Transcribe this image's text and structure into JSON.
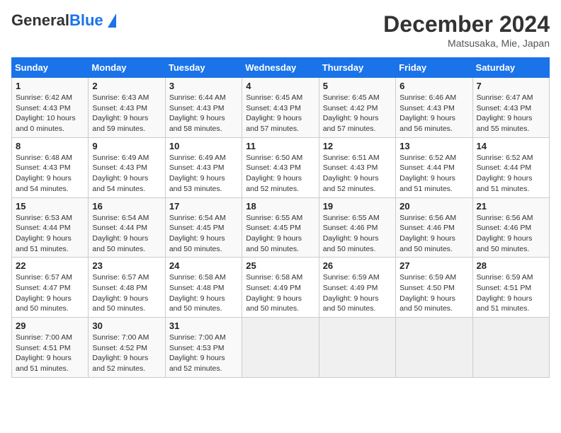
{
  "header": {
    "logo_general": "General",
    "logo_blue": "Blue",
    "title": "December 2024",
    "subtitle": "Matsusaka, Mie, Japan"
  },
  "calendar": {
    "days_of_week": [
      "Sunday",
      "Monday",
      "Tuesday",
      "Wednesday",
      "Thursday",
      "Friday",
      "Saturday"
    ],
    "weeks": [
      [
        {
          "day": "1",
          "sunrise": "Sunrise: 6:42 AM",
          "sunset": "Sunset: 4:43 PM",
          "daylight": "Daylight: 10 hours and 0 minutes."
        },
        {
          "day": "2",
          "sunrise": "Sunrise: 6:43 AM",
          "sunset": "Sunset: 4:43 PM",
          "daylight": "Daylight: 9 hours and 59 minutes."
        },
        {
          "day": "3",
          "sunrise": "Sunrise: 6:44 AM",
          "sunset": "Sunset: 4:43 PM",
          "daylight": "Daylight: 9 hours and 58 minutes."
        },
        {
          "day": "4",
          "sunrise": "Sunrise: 6:45 AM",
          "sunset": "Sunset: 4:43 PM",
          "daylight": "Daylight: 9 hours and 57 minutes."
        },
        {
          "day": "5",
          "sunrise": "Sunrise: 6:45 AM",
          "sunset": "Sunset: 4:42 PM",
          "daylight": "Daylight: 9 hours and 57 minutes."
        },
        {
          "day": "6",
          "sunrise": "Sunrise: 6:46 AM",
          "sunset": "Sunset: 4:43 PM",
          "daylight": "Daylight: 9 hours and 56 minutes."
        },
        {
          "day": "7",
          "sunrise": "Sunrise: 6:47 AM",
          "sunset": "Sunset: 4:43 PM",
          "daylight": "Daylight: 9 hours and 55 minutes."
        }
      ],
      [
        {
          "day": "8",
          "sunrise": "Sunrise: 6:48 AM",
          "sunset": "Sunset: 4:43 PM",
          "daylight": "Daylight: 9 hours and 54 minutes."
        },
        {
          "day": "9",
          "sunrise": "Sunrise: 6:49 AM",
          "sunset": "Sunset: 4:43 PM",
          "daylight": "Daylight: 9 hours and 54 minutes."
        },
        {
          "day": "10",
          "sunrise": "Sunrise: 6:49 AM",
          "sunset": "Sunset: 4:43 PM",
          "daylight": "Daylight: 9 hours and 53 minutes."
        },
        {
          "day": "11",
          "sunrise": "Sunrise: 6:50 AM",
          "sunset": "Sunset: 4:43 PM",
          "daylight": "Daylight: 9 hours and 52 minutes."
        },
        {
          "day": "12",
          "sunrise": "Sunrise: 6:51 AM",
          "sunset": "Sunset: 4:43 PM",
          "daylight": "Daylight: 9 hours and 52 minutes."
        },
        {
          "day": "13",
          "sunrise": "Sunrise: 6:52 AM",
          "sunset": "Sunset: 4:44 PM",
          "daylight": "Daylight: 9 hours and 51 minutes."
        },
        {
          "day": "14",
          "sunrise": "Sunrise: 6:52 AM",
          "sunset": "Sunset: 4:44 PM",
          "daylight": "Daylight: 9 hours and 51 minutes."
        }
      ],
      [
        {
          "day": "15",
          "sunrise": "Sunrise: 6:53 AM",
          "sunset": "Sunset: 4:44 PM",
          "daylight": "Daylight: 9 hours and 51 minutes."
        },
        {
          "day": "16",
          "sunrise": "Sunrise: 6:54 AM",
          "sunset": "Sunset: 4:44 PM",
          "daylight": "Daylight: 9 hours and 50 minutes."
        },
        {
          "day": "17",
          "sunrise": "Sunrise: 6:54 AM",
          "sunset": "Sunset: 4:45 PM",
          "daylight": "Daylight: 9 hours and 50 minutes."
        },
        {
          "day": "18",
          "sunrise": "Sunrise: 6:55 AM",
          "sunset": "Sunset: 4:45 PM",
          "daylight": "Daylight: 9 hours and 50 minutes."
        },
        {
          "day": "19",
          "sunrise": "Sunrise: 6:55 AM",
          "sunset": "Sunset: 4:46 PM",
          "daylight": "Daylight: 9 hours and 50 minutes."
        },
        {
          "day": "20",
          "sunrise": "Sunrise: 6:56 AM",
          "sunset": "Sunset: 4:46 PM",
          "daylight": "Daylight: 9 hours and 50 minutes."
        },
        {
          "day": "21",
          "sunrise": "Sunrise: 6:56 AM",
          "sunset": "Sunset: 4:46 PM",
          "daylight": "Daylight: 9 hours and 50 minutes."
        }
      ],
      [
        {
          "day": "22",
          "sunrise": "Sunrise: 6:57 AM",
          "sunset": "Sunset: 4:47 PM",
          "daylight": "Daylight: 9 hours and 50 minutes."
        },
        {
          "day": "23",
          "sunrise": "Sunrise: 6:57 AM",
          "sunset": "Sunset: 4:48 PM",
          "daylight": "Daylight: 9 hours and 50 minutes."
        },
        {
          "day": "24",
          "sunrise": "Sunrise: 6:58 AM",
          "sunset": "Sunset: 4:48 PM",
          "daylight": "Daylight: 9 hours and 50 minutes."
        },
        {
          "day": "25",
          "sunrise": "Sunrise: 6:58 AM",
          "sunset": "Sunset: 4:49 PM",
          "daylight": "Daylight: 9 hours and 50 minutes."
        },
        {
          "day": "26",
          "sunrise": "Sunrise: 6:59 AM",
          "sunset": "Sunset: 4:49 PM",
          "daylight": "Daylight: 9 hours and 50 minutes."
        },
        {
          "day": "27",
          "sunrise": "Sunrise: 6:59 AM",
          "sunset": "Sunset: 4:50 PM",
          "daylight": "Daylight: 9 hours and 50 minutes."
        },
        {
          "day": "28",
          "sunrise": "Sunrise: 6:59 AM",
          "sunset": "Sunset: 4:51 PM",
          "daylight": "Daylight: 9 hours and 51 minutes."
        }
      ],
      [
        {
          "day": "29",
          "sunrise": "Sunrise: 7:00 AM",
          "sunset": "Sunset: 4:51 PM",
          "daylight": "Daylight: 9 hours and 51 minutes."
        },
        {
          "day": "30",
          "sunrise": "Sunrise: 7:00 AM",
          "sunset": "Sunset: 4:52 PM",
          "daylight": "Daylight: 9 hours and 52 minutes."
        },
        {
          "day": "31",
          "sunrise": "Sunrise: 7:00 AM",
          "sunset": "Sunset: 4:53 PM",
          "daylight": "Daylight: 9 hours and 52 minutes."
        },
        null,
        null,
        null,
        null
      ]
    ]
  }
}
